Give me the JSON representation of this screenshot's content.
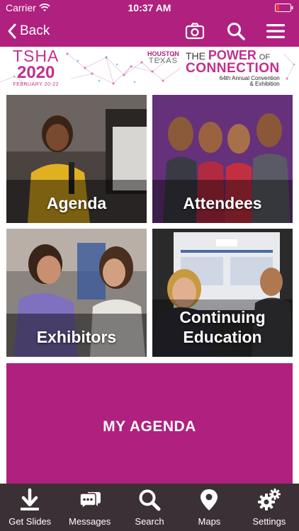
{
  "status_bar": {
    "carrier": "Carrier",
    "time": "10:37 AM"
  },
  "nav": {
    "back_label": "Back"
  },
  "banner": {
    "org": "TSHA",
    "year": "2020",
    "dates": "FEBRUARY 20-22",
    "city": "HOUSTON",
    "state": "TEXAS",
    "tagline_the": "THE",
    "tagline_power": "POWER",
    "tagline_of": "OF",
    "tagline_connection": "CONNECTION",
    "convention_line1": "64th Annual Convention",
    "convention_line2": "& Exhibition"
  },
  "tiles": {
    "agenda": "Agenda",
    "attendees": "Attendees",
    "exhibitors": "Exhibitors",
    "continuing_education_line1": "Continuing",
    "continuing_education_line2": "Education",
    "my_agenda": "MY AGENDA"
  },
  "tab_bar": {
    "get_slides": "Get Slides",
    "messages": "Messages",
    "search": "Search",
    "maps": "Maps",
    "settings": "Settings"
  },
  "colors": {
    "brand": "#b0207e",
    "tab_bar": "#3b3035",
    "accent_pink": "#c22f8e"
  }
}
